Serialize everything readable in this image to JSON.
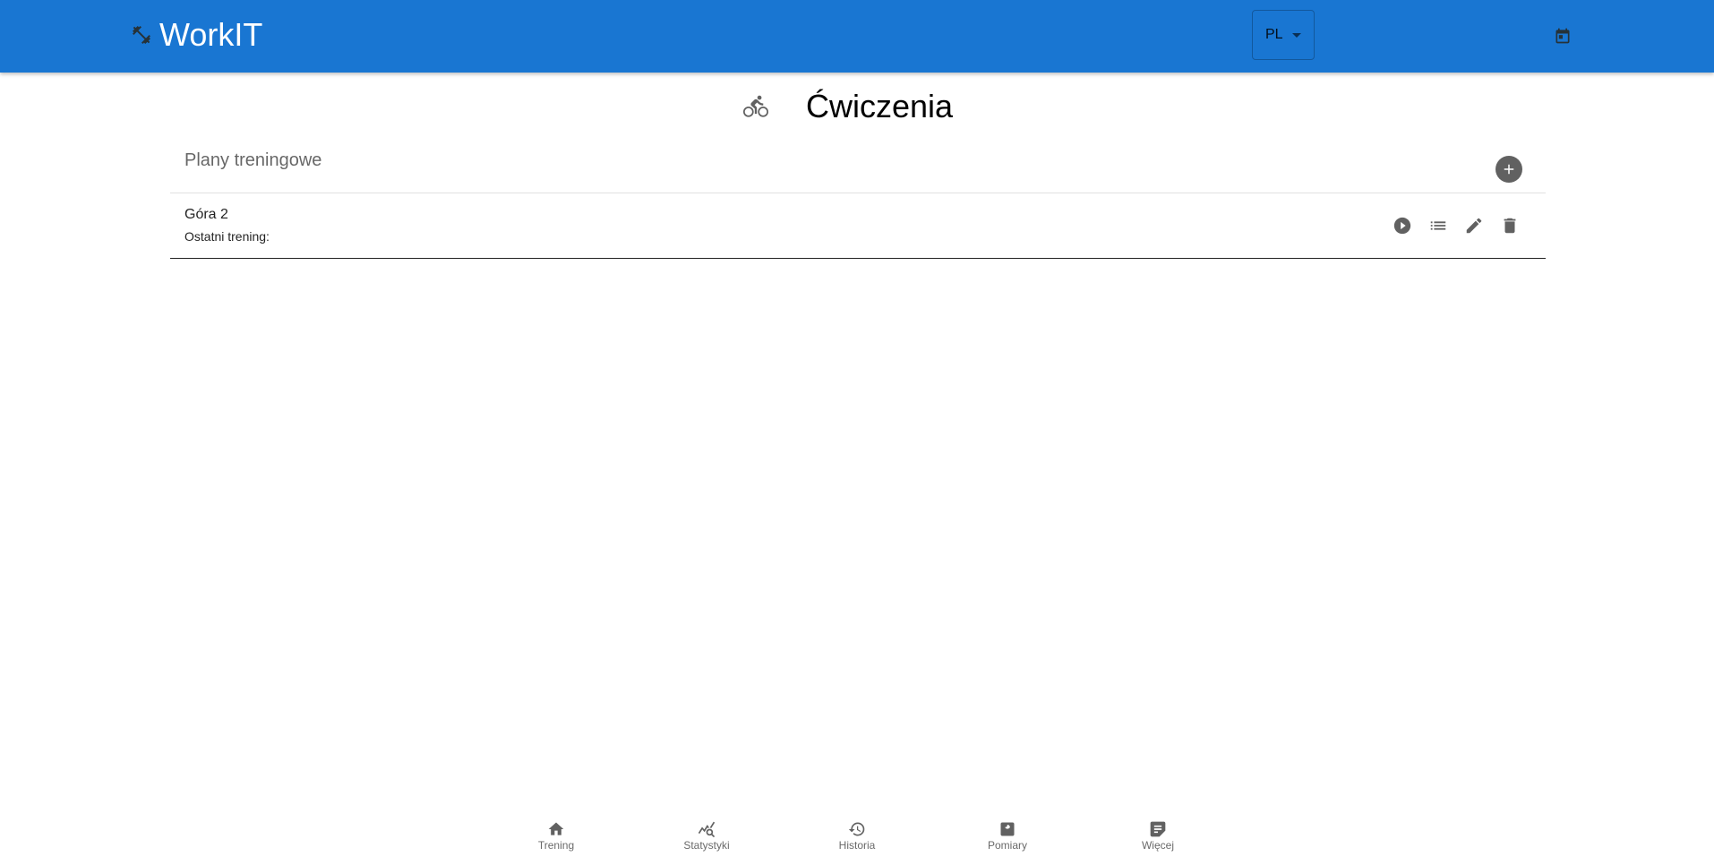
{
  "app": {
    "title": "WorkIT",
    "brand_icon": "dumbbell-icon"
  },
  "header": {
    "language": {
      "selected": "PL"
    },
    "calendar_icon": "calendar-icon"
  },
  "page": {
    "icon": "bike-icon",
    "title": "Ćwiczenia"
  },
  "plans": {
    "title": "Plany treningowe",
    "add_icon": "add-circle-icon",
    "items": [
      {
        "name": "Góra 2",
        "last_training": "Ostatni trening:",
        "actions": [
          "play-icon",
          "list-icon",
          "edit-icon",
          "delete-icon"
        ]
      }
    ]
  },
  "bottom_nav": {
    "items": [
      {
        "label": "Trening",
        "icon": "home-icon"
      },
      {
        "label": "Statystyki",
        "icon": "stats-icon"
      },
      {
        "label": "Historia",
        "icon": "history-icon"
      },
      {
        "label": "Pomiary",
        "icon": "scale-icon"
      },
      {
        "label": "Więcej",
        "icon": "more-icon"
      }
    ]
  },
  "colors": {
    "primary": "#1976d2",
    "icon": "#616161",
    "text": "#000000"
  }
}
